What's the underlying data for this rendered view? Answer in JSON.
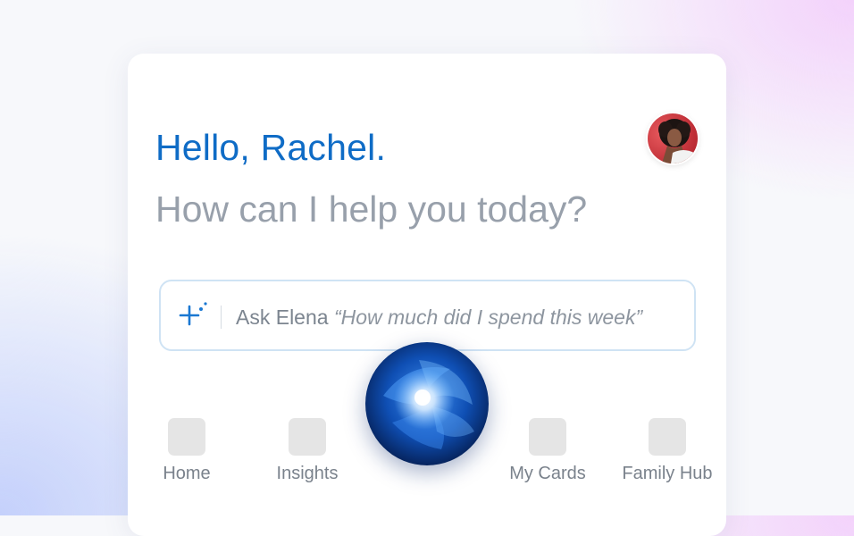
{
  "greeting": {
    "hello": "Hello, Rachel.",
    "prompt": "How can I help you today?"
  },
  "avatar": {
    "icon": "user-avatar"
  },
  "ask": {
    "icon": "sparkle-icon",
    "prefix": "Ask Elena",
    "example": "“How much did I spend this week”"
  },
  "assistant": {
    "icon": "assistant-orb"
  },
  "nav": {
    "items": [
      {
        "label": "Home"
      },
      {
        "label": "Insights"
      },
      {
        "label": "My Cards"
      },
      {
        "label": "Family Hub"
      }
    ]
  },
  "colors": {
    "accent": "#0f6cc6",
    "muted_text": "#98a0ab",
    "input_border": "#cfe3f4",
    "nav_icon_placeholder": "#e5e5e5"
  }
}
